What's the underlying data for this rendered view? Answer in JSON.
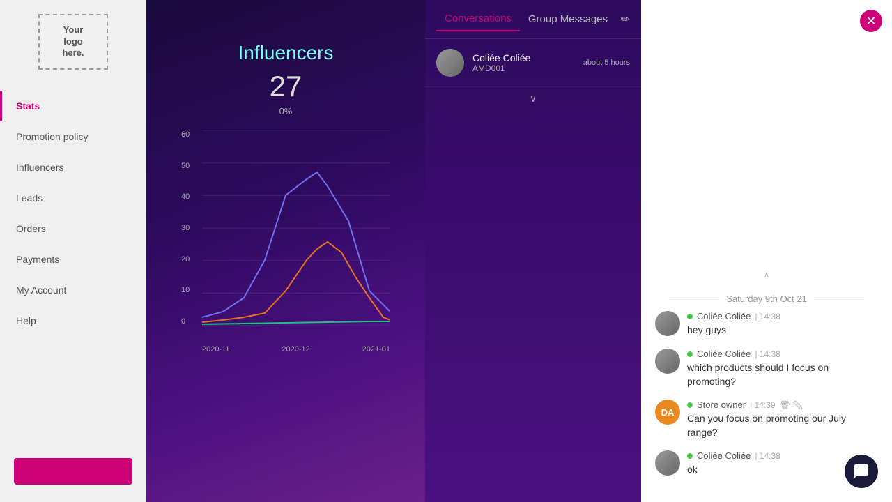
{
  "logo": {
    "text": "Your\nlogo\nhere."
  },
  "sidebar": {
    "items": [
      {
        "id": "stats",
        "label": "Stats",
        "active": true
      },
      {
        "id": "promotion-policy",
        "label": "Promotion policy",
        "active": false
      },
      {
        "id": "influencers",
        "label": "Influencers",
        "active": false
      },
      {
        "id": "leads",
        "label": "Leads",
        "active": false
      },
      {
        "id": "orders",
        "label": "Orders",
        "active": false
      },
      {
        "id": "payments",
        "label": "Payments",
        "active": false
      },
      {
        "id": "my-account",
        "label": "My Account",
        "active": false
      },
      {
        "id": "help",
        "label": "Help",
        "active": false
      }
    ]
  },
  "stats": {
    "influencers_label": "Influencers",
    "influencers_count": "27",
    "influencers_pct": "0%",
    "chart": {
      "y_labels": [
        "60",
        "50",
        "40",
        "30",
        "20",
        "10",
        "0"
      ],
      "x_labels": [
        "2020-11",
        "2020-12",
        "2021-01"
      ]
    }
  },
  "conversations": {
    "tab_conversations": "Conversations",
    "tab_group_messages": "Group Messages",
    "edit_icon": "✏",
    "items": [
      {
        "name": "Coliée Coliée",
        "sub": "AMD001",
        "time": "about 5 hours"
      }
    ],
    "chevron": "∨"
  },
  "chat": {
    "date_divider": "Saturday 9th Oct 21",
    "chevron_up": "∧",
    "messages": [
      {
        "id": "msg1",
        "sender": "Coliée Coliée",
        "time": "14:38",
        "text": "hey guys",
        "type": "user",
        "initials": ""
      },
      {
        "id": "msg2",
        "sender": "Coliée Coliée",
        "time": "14:38",
        "text": "which products should I focus on promoting?",
        "type": "user",
        "initials": ""
      },
      {
        "id": "msg3",
        "sender": "Store owner",
        "time": "14:39",
        "text": "Can you focus on promoting our July range?",
        "type": "owner",
        "initials": "DA"
      },
      {
        "id": "msg4",
        "sender": "Coliée Coliée",
        "time": "14:38",
        "text": "ok",
        "type": "user",
        "initials": ""
      }
    ]
  }
}
